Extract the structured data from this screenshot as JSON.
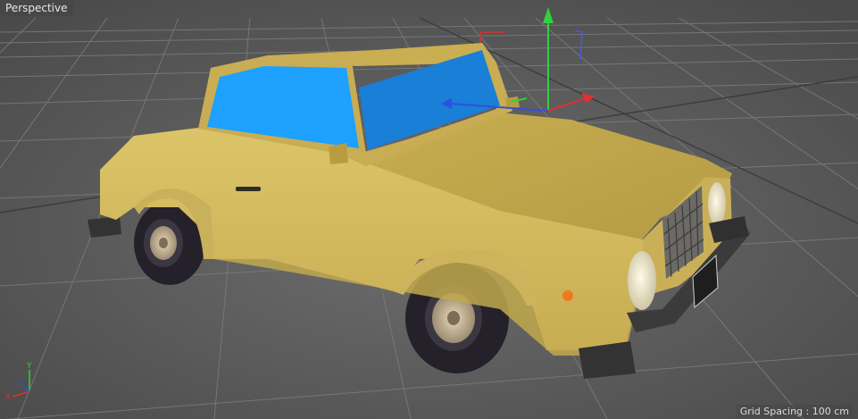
{
  "viewport": {
    "name": "Perspective",
    "grid_spacing_text": "Grid Spacing : 100 cm"
  },
  "axis_widget": {
    "x": "X",
    "y": "Y",
    "z": "Z"
  },
  "colors": {
    "background": "#5e5e5e",
    "grid_line": "#777777",
    "car_body": "#d9c064",
    "car_body_shadow": "#b59f4a",
    "windows": "#1ea0ff",
    "tire": "#2a2730",
    "bumper": "#3a3a3a",
    "axis_x": "#e03030",
    "axis_y": "#30d040",
    "axis_z": "#3050e0"
  },
  "scene_object": "car-model"
}
